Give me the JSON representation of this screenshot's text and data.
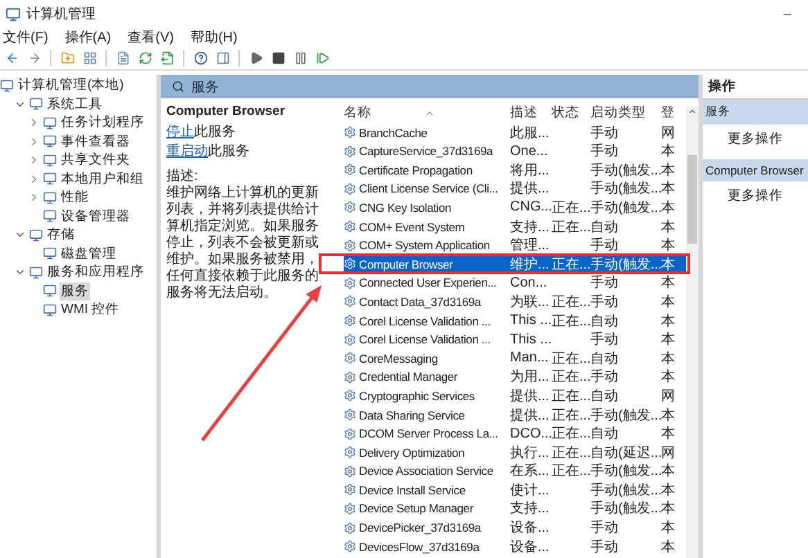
{
  "window": {
    "title": "计算机管理",
    "controls": [
      "–"
    ]
  },
  "menu": [
    "文件(F)",
    "操作(A)",
    "查看(V)",
    "帮助(H)"
  ],
  "tree": [
    {
      "label": "计算机管理(本地)",
      "selected": false,
      "children": [
        {
          "label": "系统工具",
          "expanded": true,
          "selected": false,
          "children": [
            {
              "label": "任务计划程序",
              "expanded": false,
              "selected": false
            },
            {
              "label": "事件查看器",
              "expanded": false,
              "selected": false
            },
            {
              "label": "共享文件夹",
              "expanded": false,
              "selected": false
            },
            {
              "label": "本地用户和组",
              "expanded": false,
              "selected": false
            },
            {
              "label": "性能",
              "expanded": false,
              "selected": false
            },
            {
              "label": "设备管理器",
              "selected": false
            }
          ]
        },
        {
          "label": "存储",
          "expanded": true,
          "selected": false,
          "children": [
            {
              "label": "磁盘管理",
              "selected": false
            }
          ]
        },
        {
          "label": "服务和应用程序",
          "expanded": true,
          "selected": false,
          "children": [
            {
              "label": "服务",
              "selected": true
            },
            {
              "label": "WMI 控件",
              "selected": false
            }
          ]
        }
      ]
    }
  ],
  "services_header": "服务",
  "detail": {
    "title": "Computer Browser",
    "actions": [
      {
        "link": "停止",
        "rest": "此服务"
      },
      {
        "link": "重启动",
        "rest": "此服务"
      }
    ],
    "description_label": "描述:",
    "description": "维护网络上计算机的更新列表，并将列表提供给计算机指定浏览。如果服务停止，列表不会被更新或维护。如果服务被禁用，任何直接依赖于此服务的服务将无法启动。"
  },
  "table": {
    "columns": [
      "名称",
      "描述",
      "状态",
      "启动类型",
      "登"
    ],
    "rows": [
      {
        "cells": [
          "BranchCache",
          "此服...",
          "",
          "手动",
          "网"
        ],
        "selected": false
      },
      {
        "cells": [
          "CaptureService_37d3169a",
          "One...",
          "",
          "手动",
          "本"
        ],
        "selected": false
      },
      {
        "cells": [
          "Certificate Propagation",
          "将用...",
          "",
          "手动(触发...",
          "本"
        ],
        "selected": false
      },
      {
        "cells": [
          "Client License Service (Cli...",
          "提供...",
          "",
          "手动(触发...",
          "本"
        ],
        "selected": false
      },
      {
        "cells": [
          "CNG Key Isolation",
          "CNG...",
          "正在...",
          "手动(触发...",
          "本"
        ],
        "selected": false
      },
      {
        "cells": [
          "COM+ Event System",
          "支持...",
          "正在...",
          "自动",
          "本"
        ],
        "selected": false
      },
      {
        "cells": [
          "COM+ System Application",
          "管理...",
          "",
          "手动",
          "本"
        ],
        "selected": false
      },
      {
        "cells": [
          "Computer Browser",
          "维护...",
          "正在...",
          "手动(触发...",
          "本"
        ],
        "selected": true
      },
      {
        "cells": [
          "Connected User Experien...",
          "Con...",
          "",
          "手动",
          "本"
        ],
        "selected": false
      },
      {
        "cells": [
          "Contact Data_37d3169a",
          "为联...",
          "正在...",
          "手动",
          "本"
        ],
        "selected": false
      },
      {
        "cells": [
          "Corel License Validation ...",
          "This ...",
          "正在...",
          "自动",
          "本"
        ],
        "selected": false
      },
      {
        "cells": [
          "Corel License Validation ...",
          "This ...",
          "",
          "手动",
          "本"
        ],
        "selected": false
      },
      {
        "cells": [
          "CoreMessaging",
          "Man...",
          "正在...",
          "自动",
          "本"
        ],
        "selected": false
      },
      {
        "cells": [
          "Credential Manager",
          "为用...",
          "正在...",
          "手动",
          "本"
        ],
        "selected": false
      },
      {
        "cells": [
          "Cryptographic Services",
          "提供...",
          "正在...",
          "自动",
          "网"
        ],
        "selected": false
      },
      {
        "cells": [
          "Data Sharing Service",
          "提供...",
          "正在...",
          "手动(触发...",
          "本"
        ],
        "selected": false
      },
      {
        "cells": [
          "DCOM Server Process La...",
          "DCO...",
          "正在...",
          "自动",
          "本"
        ],
        "selected": false
      },
      {
        "cells": [
          "Delivery Optimization",
          "执行...",
          "正在...",
          "自动(延迟...",
          "网"
        ],
        "selected": false
      },
      {
        "cells": [
          "Device Association Service",
          "在系...",
          "正在...",
          "手动(触发...",
          "本"
        ],
        "selected": false
      },
      {
        "cells": [
          "Device Install Service",
          "使计...",
          "",
          "手动(触发...",
          "本"
        ],
        "selected": false
      },
      {
        "cells": [
          "Device Setup Manager",
          "支持...",
          "",
          "手动(触发...",
          "本"
        ],
        "selected": false
      },
      {
        "cells": [
          "DevicePicker_37d3169a",
          "设备...",
          "",
          "手动",
          "本"
        ],
        "selected": false
      },
      {
        "cells": [
          "DevicesFlow_37d3169a",
          "设备...",
          "",
          "手动",
          "本"
        ],
        "selected": false
      }
    ]
  },
  "actions_panel": {
    "title": "操作",
    "sections": [
      {
        "title": "服务",
        "items": [
          "更多操作"
        ]
      },
      {
        "title": "Computer Browser",
        "items": [
          "更多操作"
        ]
      }
    ]
  }
}
